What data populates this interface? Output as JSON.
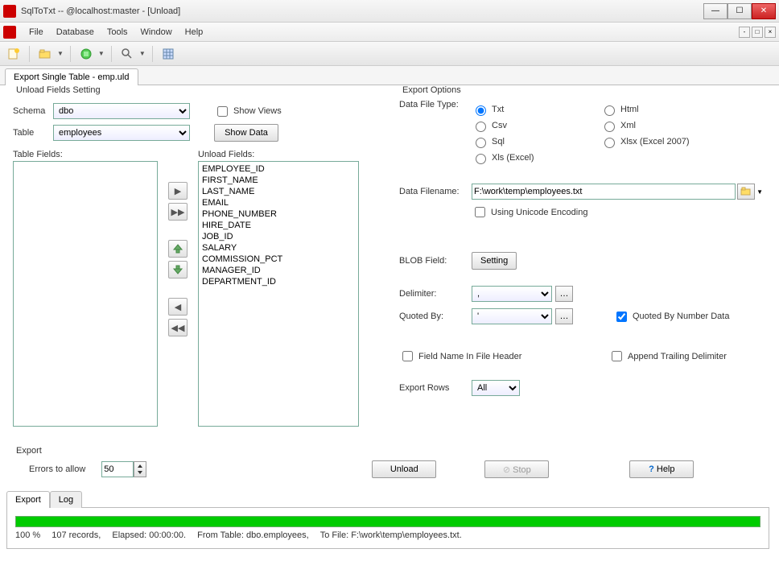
{
  "window": {
    "title": "SqlToTxt -- @localhost:master - [Unload]"
  },
  "menus": [
    "File",
    "Database",
    "Tools",
    "Window",
    "Help"
  ],
  "doc_tab": "Export Single Table - emp.uld",
  "unload_section": {
    "legend": "Unload Fields Setting",
    "schema_label": "Schema",
    "schema_value": "dbo",
    "table_label": "Table",
    "table_value": "employees",
    "show_views_label": "Show Views",
    "show_data_label": "Show Data",
    "table_fields_label": "Table Fields:",
    "unload_fields_label": "Unload Fields:",
    "unload_fields": [
      "EMPLOYEE_ID",
      "FIRST_NAME",
      "LAST_NAME",
      "EMAIL",
      "PHONE_NUMBER",
      "HIRE_DATE",
      "JOB_ID",
      "SALARY",
      "COMMISSION_PCT",
      "MANAGER_ID",
      "DEPARTMENT_ID"
    ]
  },
  "options": {
    "legend": "Export Options",
    "filetype_label": "Data File Type:",
    "types": {
      "txt": "Txt",
      "csv": "Csv",
      "sql": "Sql",
      "xls": "Xls (Excel)",
      "html": "Html",
      "xml": "Xml",
      "xlsx": "Xlsx (Excel 2007)"
    },
    "filename_label": "Data Filename:",
    "filename_value": "F:\\work\\temp\\employees.txt",
    "unicode_label": "Using Unicode Encoding",
    "blob_label": "BLOB Field:",
    "blob_btn": "Setting",
    "delimiter_label": "Delimiter:",
    "delimiter_value": ",",
    "quoted_label": "Quoted By:",
    "quoted_value": "'",
    "quoted_num_label": "Quoted By Number Data",
    "field_header_label": "Field Name In File Header",
    "append_delim_label": "Append Trailing Delimiter",
    "export_rows_label": "Export Rows",
    "export_rows_value": "All"
  },
  "export_section": {
    "legend": "Export",
    "errors_label": "Errors to allow",
    "errors_value": "50",
    "unload_btn": "Unload",
    "stop_btn": "Stop",
    "help_btn": "Help"
  },
  "bottom_tabs": {
    "export": "Export",
    "log": "Log"
  },
  "status": {
    "percent": "100 %",
    "records": "107 records,",
    "elapsed": "Elapsed: 00:00:00.",
    "from": "From Table: dbo.employees,",
    "to": "To File: F:\\work\\temp\\employees.txt."
  }
}
